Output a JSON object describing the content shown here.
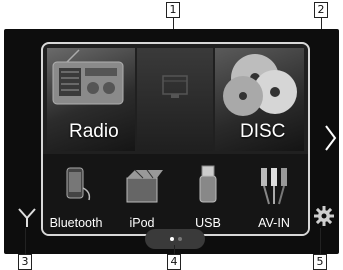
{
  "screen": {
    "tiles": {
      "radio_label": "Radio",
      "disc_label": "DISC"
    },
    "sources": [
      {
        "label": "Bluetooth",
        "icon": "phone-icon"
      },
      {
        "label": "iPod",
        "icon": "ipod-icon"
      },
      {
        "label": "USB",
        "icon": "usb-icon"
      },
      {
        "label": "AV-IN",
        "icon": "av-cable-icon"
      }
    ],
    "page_indicator": {
      "current": 1,
      "total": 2
    },
    "next_icon": "chevron-right-icon",
    "bottom_left_icon": "home-fork-icon",
    "settings_icon": "gear-icon"
  },
  "callouts": {
    "c1": "1",
    "c2": "2",
    "c3": "3",
    "c4": "4",
    "c5": "5"
  },
  "colors": {
    "screen_bg": "#0d0d0d",
    "frame": "#d8d8d8",
    "text": "#ffffff",
    "dot_active": "#ffffff",
    "dot_inactive": "#777777"
  }
}
